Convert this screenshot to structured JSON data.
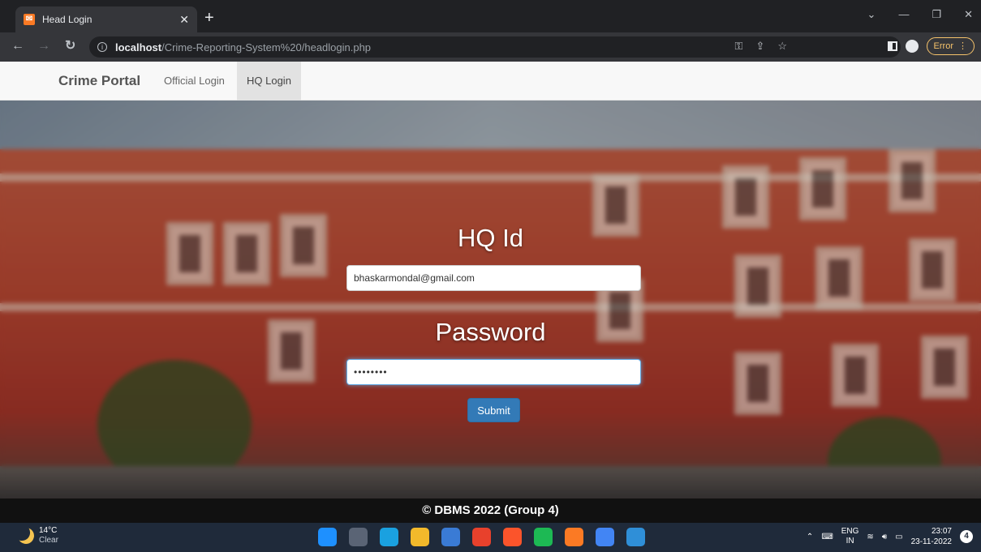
{
  "browser": {
    "tab_title": "Head Login",
    "tab_favicon_glyph": "✉",
    "new_tab_glyph": "+",
    "url_host": "localhost",
    "url_path": "/Crime-Reporting-System%20/headlogin.php",
    "error_label": "Error",
    "icons": [
      "back-arrow-icon",
      "forward-arrow-icon",
      "reload-icon",
      "info-icon",
      "key-icon",
      "share-icon",
      "star-icon",
      "side-panel-icon",
      "profile-icon",
      "kebab-menu-icon"
    ]
  },
  "navbar": {
    "brand": "Crime Portal",
    "links": [
      {
        "label": "Official Login",
        "active": false
      },
      {
        "label": "HQ Login",
        "active": true
      }
    ]
  },
  "form": {
    "hq_id_label": "HQ Id",
    "hq_id_value": "bhaskarmondal@gmail.com",
    "password_label": "Password",
    "password_value": "••••••••",
    "submit_label": "Submit"
  },
  "footer": {
    "text": "© DBMS 2022 (Group 4)"
  },
  "taskbar": {
    "weather_temp": "14°C",
    "weather_desc": "Clear",
    "lang_top": "ENG",
    "lang_bottom": "IN",
    "time": "23:07",
    "date": "23-11-2022",
    "notification_count": "4",
    "app_colors": [
      "#1e90ff",
      "#5a6475",
      "#1aa1e0",
      "#f2b92b",
      "#3a7bd5",
      "#e8412c",
      "#fb542b",
      "#1db954",
      "#fb7a24",
      "#4285f4",
      "#2f8fd8"
    ]
  },
  "colors": {
    "accent": "#337ab7",
    "error": "#f6c36b"
  }
}
